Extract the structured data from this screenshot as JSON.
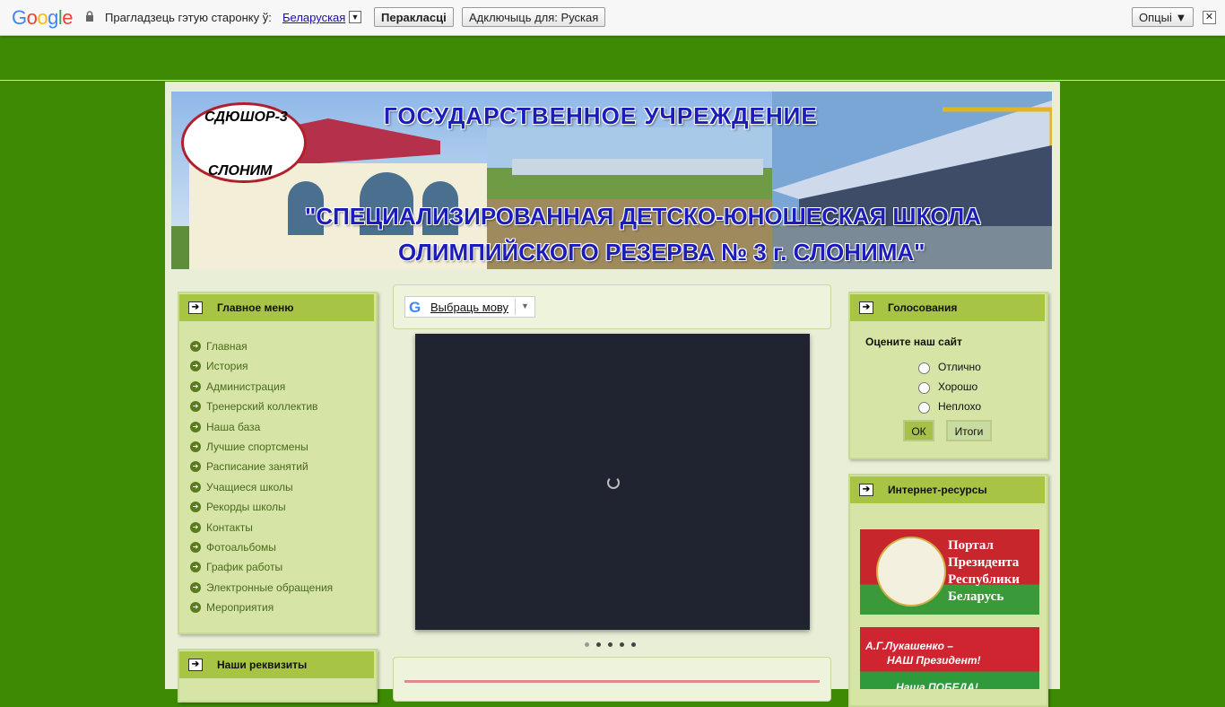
{
  "translate_bar": {
    "logo": "Google",
    "prompt": "Прагладзець гэтую старонку ў:",
    "language": "Беларуская",
    "translate_button": "Перакласці",
    "disable_button": "Адключыць для: Руская",
    "options_button": "Опцыі ▼",
    "close": "✕"
  },
  "header": {
    "line1": "ГОСУДАРСТВЕННОЕ  УЧРЕЖДЕНИЕ",
    "line2": "\"СПЕЦИАЛИЗИРОВАННАЯ ДЕТСКО-ЮНОШЕСКАЯ ШКОЛА",
    "line3": "ОЛИМПИЙСКОГО РЕЗЕРВА № 3  г. СЛОНИМА\"",
    "logo_top": "СДЮШОР-3",
    "logo_bottom": "СЛОНИМ"
  },
  "main_menu": {
    "title": "Главное меню",
    "items": [
      "Главная",
      "История",
      "Администрация",
      "Тренерский коллектив",
      "Наша база",
      "Лучшие спортсмены",
      "Расписание занятий",
      "Учащиеся школы",
      "Рекорды школы",
      "Контакты",
      "Фотоальбомы",
      "График работы",
      "Электронные обращения",
      "Мероприятия"
    ]
  },
  "requisites": {
    "title": "Наши реквизиты"
  },
  "translate_widget": {
    "label": "Выбраць мову",
    "arrow": "▼"
  },
  "slider": {
    "dots": 5,
    "active_dot": 1
  },
  "polls": {
    "title": "Голосования",
    "question": "Оцените наш сайт",
    "options": [
      "Отлично",
      "Хорошо",
      "Неплохо"
    ],
    "ok_button": "ОК",
    "results_button": "Итоги"
  },
  "resources": {
    "title": "Интернет-ресурсы",
    "banner1": [
      "Портал",
      "Президента",
      "Республики",
      "Беларусь"
    ],
    "banner2": [
      "А.Г.Лукашенко –",
      "НАШ Президент!",
      "Наша ПОБЕДА!"
    ]
  },
  "colors": {
    "page_bg": "#3f8a05",
    "panel_bg": "#d6e4a6",
    "panel_title": "#a7c444",
    "header_text": "#1c1cb8"
  }
}
